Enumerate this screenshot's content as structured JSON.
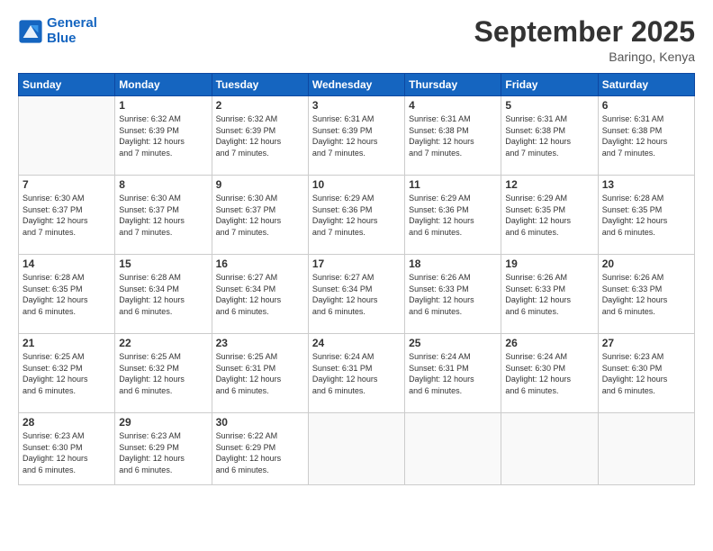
{
  "header": {
    "logo_line1": "General",
    "logo_line2": "Blue",
    "month": "September 2025",
    "location": "Baringo, Kenya"
  },
  "days_of_week": [
    "Sunday",
    "Monday",
    "Tuesday",
    "Wednesday",
    "Thursday",
    "Friday",
    "Saturday"
  ],
  "weeks": [
    [
      {
        "day": "",
        "info": ""
      },
      {
        "day": "1",
        "info": "Sunrise: 6:32 AM\nSunset: 6:39 PM\nDaylight: 12 hours\nand 7 minutes."
      },
      {
        "day": "2",
        "info": "Sunrise: 6:32 AM\nSunset: 6:39 PM\nDaylight: 12 hours\nand 7 minutes."
      },
      {
        "day": "3",
        "info": "Sunrise: 6:31 AM\nSunset: 6:39 PM\nDaylight: 12 hours\nand 7 minutes."
      },
      {
        "day": "4",
        "info": "Sunrise: 6:31 AM\nSunset: 6:38 PM\nDaylight: 12 hours\nand 7 minutes."
      },
      {
        "day": "5",
        "info": "Sunrise: 6:31 AM\nSunset: 6:38 PM\nDaylight: 12 hours\nand 7 minutes."
      },
      {
        "day": "6",
        "info": "Sunrise: 6:31 AM\nSunset: 6:38 PM\nDaylight: 12 hours\nand 7 minutes."
      }
    ],
    [
      {
        "day": "7",
        "info": "Sunrise: 6:30 AM\nSunset: 6:37 PM\nDaylight: 12 hours\nand 7 minutes."
      },
      {
        "day": "8",
        "info": "Sunrise: 6:30 AM\nSunset: 6:37 PM\nDaylight: 12 hours\nand 7 minutes."
      },
      {
        "day": "9",
        "info": "Sunrise: 6:30 AM\nSunset: 6:37 PM\nDaylight: 12 hours\nand 7 minutes."
      },
      {
        "day": "10",
        "info": "Sunrise: 6:29 AM\nSunset: 6:36 PM\nDaylight: 12 hours\nand 7 minutes."
      },
      {
        "day": "11",
        "info": "Sunrise: 6:29 AM\nSunset: 6:36 PM\nDaylight: 12 hours\nand 6 minutes."
      },
      {
        "day": "12",
        "info": "Sunrise: 6:29 AM\nSunset: 6:35 PM\nDaylight: 12 hours\nand 6 minutes."
      },
      {
        "day": "13",
        "info": "Sunrise: 6:28 AM\nSunset: 6:35 PM\nDaylight: 12 hours\nand 6 minutes."
      }
    ],
    [
      {
        "day": "14",
        "info": "Sunrise: 6:28 AM\nSunset: 6:35 PM\nDaylight: 12 hours\nand 6 minutes."
      },
      {
        "day": "15",
        "info": "Sunrise: 6:28 AM\nSunset: 6:34 PM\nDaylight: 12 hours\nand 6 minutes."
      },
      {
        "day": "16",
        "info": "Sunrise: 6:27 AM\nSunset: 6:34 PM\nDaylight: 12 hours\nand 6 minutes."
      },
      {
        "day": "17",
        "info": "Sunrise: 6:27 AM\nSunset: 6:34 PM\nDaylight: 12 hours\nand 6 minutes."
      },
      {
        "day": "18",
        "info": "Sunrise: 6:26 AM\nSunset: 6:33 PM\nDaylight: 12 hours\nand 6 minutes."
      },
      {
        "day": "19",
        "info": "Sunrise: 6:26 AM\nSunset: 6:33 PM\nDaylight: 12 hours\nand 6 minutes."
      },
      {
        "day": "20",
        "info": "Sunrise: 6:26 AM\nSunset: 6:33 PM\nDaylight: 12 hours\nand 6 minutes."
      }
    ],
    [
      {
        "day": "21",
        "info": "Sunrise: 6:25 AM\nSunset: 6:32 PM\nDaylight: 12 hours\nand 6 minutes."
      },
      {
        "day": "22",
        "info": "Sunrise: 6:25 AM\nSunset: 6:32 PM\nDaylight: 12 hours\nand 6 minutes."
      },
      {
        "day": "23",
        "info": "Sunrise: 6:25 AM\nSunset: 6:31 PM\nDaylight: 12 hours\nand 6 minutes."
      },
      {
        "day": "24",
        "info": "Sunrise: 6:24 AM\nSunset: 6:31 PM\nDaylight: 12 hours\nand 6 minutes."
      },
      {
        "day": "25",
        "info": "Sunrise: 6:24 AM\nSunset: 6:31 PM\nDaylight: 12 hours\nand 6 minutes."
      },
      {
        "day": "26",
        "info": "Sunrise: 6:24 AM\nSunset: 6:30 PM\nDaylight: 12 hours\nand 6 minutes."
      },
      {
        "day": "27",
        "info": "Sunrise: 6:23 AM\nSunset: 6:30 PM\nDaylight: 12 hours\nand 6 minutes."
      }
    ],
    [
      {
        "day": "28",
        "info": "Sunrise: 6:23 AM\nSunset: 6:30 PM\nDaylight: 12 hours\nand 6 minutes."
      },
      {
        "day": "29",
        "info": "Sunrise: 6:23 AM\nSunset: 6:29 PM\nDaylight: 12 hours\nand 6 minutes."
      },
      {
        "day": "30",
        "info": "Sunrise: 6:22 AM\nSunset: 6:29 PM\nDaylight: 12 hours\nand 6 minutes."
      },
      {
        "day": "",
        "info": ""
      },
      {
        "day": "",
        "info": ""
      },
      {
        "day": "",
        "info": ""
      },
      {
        "day": "",
        "info": ""
      }
    ]
  ]
}
